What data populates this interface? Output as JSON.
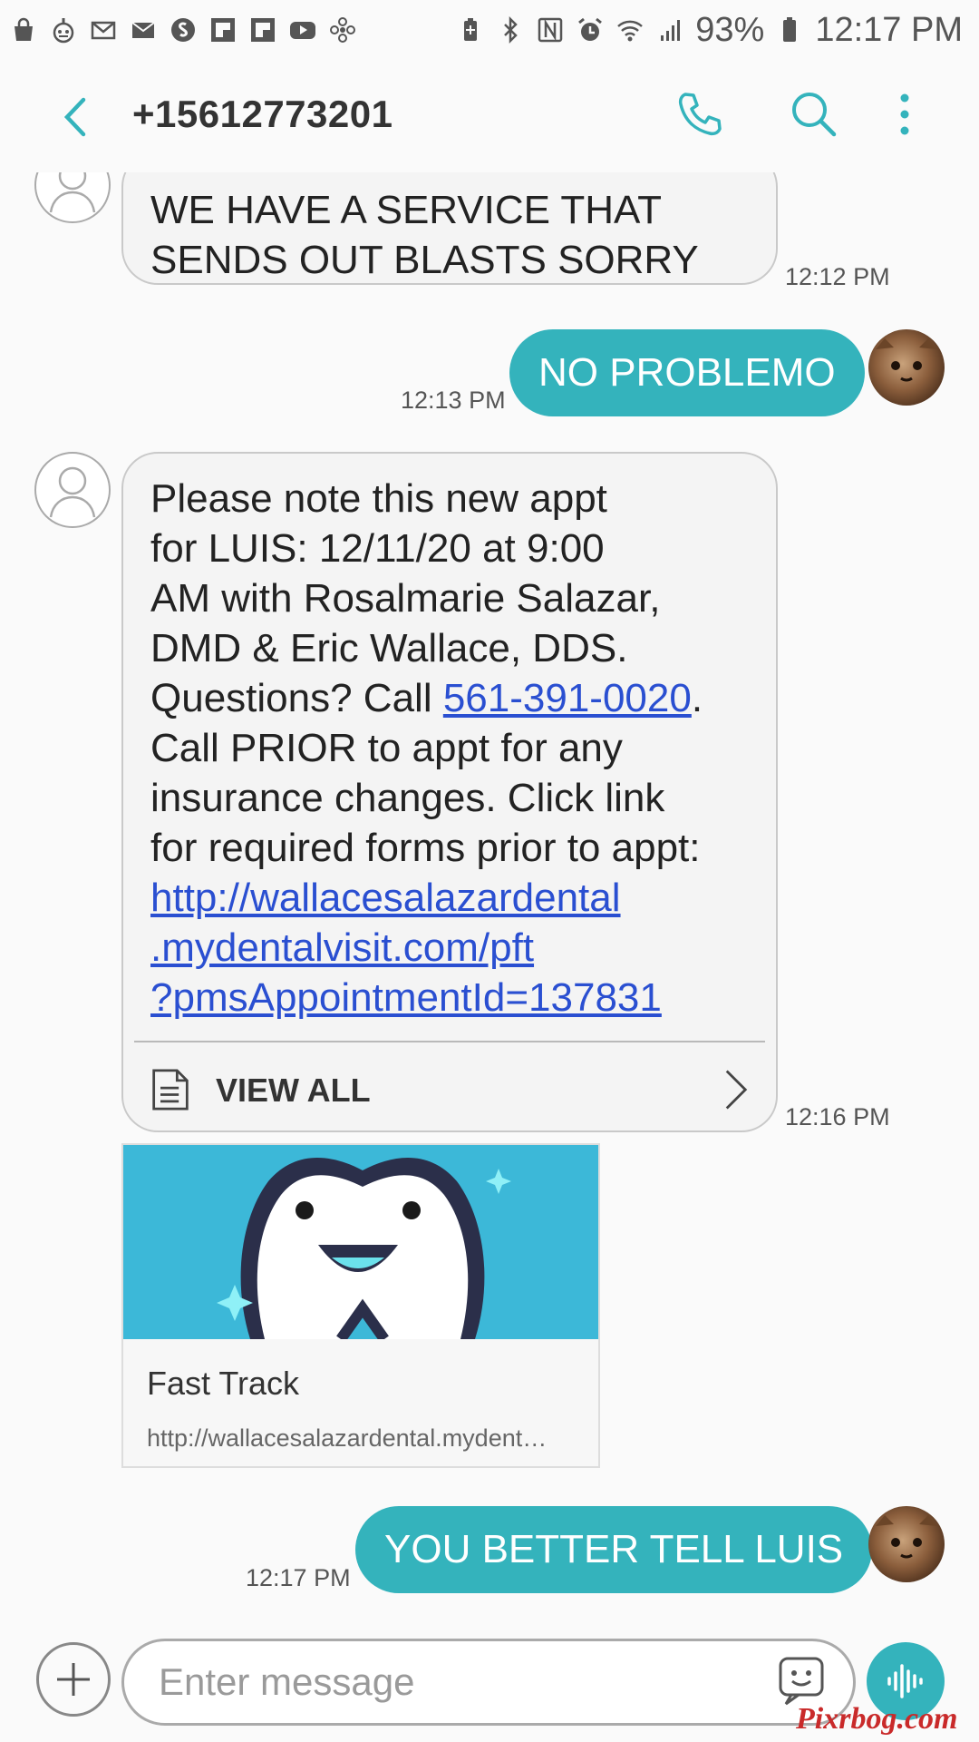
{
  "status_bar": {
    "left_icons": [
      "shopping-bag-icon",
      "bot-icon",
      "gmail-icon",
      "mail-icon",
      "shazam-icon",
      "flipboard-icon",
      "flipboard-icon",
      "youtube-icon",
      "fan-icon"
    ],
    "right_icons": [
      "battery-saver-icon",
      "bluetooth-icon",
      "nfc-icon",
      "alarm-icon",
      "wifi-icon",
      "signal-icon",
      "battery-icon"
    ],
    "battery": "93%",
    "time": "12:17 PM"
  },
  "header": {
    "title": "+15612773201",
    "icons": [
      "back-arrow-icon",
      "phone-icon",
      "search-icon",
      "more-vert-icon"
    ]
  },
  "messages": [
    {
      "direction": "incoming",
      "lines": [
        "WE HAVE A SERVICE THAT",
        "SENDS OUT BLASTS SORRY"
      ],
      "time": "12:12 PM"
    },
    {
      "direction": "outgoing",
      "text": "NO PROBLEMO",
      "time": "12:13 PM"
    },
    {
      "direction": "incoming",
      "lines": [
        "Please note this new appt",
        "for LUIS: 12/11/20 at 9:00",
        "AM with Rosalmarie Salazar,",
        "DMD & Eric Wallace, DDS."
      ],
      "questions_prefix": "Questions? Call ",
      "phone_link": "561-391-0020",
      "questions_suffix": ".",
      "lines_after": [
        "Call PRIOR to appt for any",
        "insurance changes. Click link",
        "for required forms prior to appt:"
      ],
      "url_lines": [
        "http://wallacesalazardental",
        ".mydentalvisit.com/pft",
        "?pmsAppointmentId=137831"
      ],
      "view_all_label": "VIEW ALL",
      "time": "12:16 PM"
    },
    {
      "direction": "outgoing",
      "text": "YOU BETTER TELL LUIS",
      "time": "12:17 PM"
    }
  ],
  "link_preview": {
    "title": "Fast Track",
    "url": "http://wallacesalazardental.mydent…",
    "image_icon": "tooth-mascot-icon",
    "image_color": "#3cb8d8"
  },
  "composer": {
    "placeholder": "Enter message",
    "icons": [
      "add-icon",
      "emoji-icon",
      "voice-icon"
    ]
  },
  "colors": {
    "accent": "#34b3bc",
    "link": "#2a4fd1",
    "incoming_bubble": "#f4f4f4"
  },
  "watermark": "Pixrbog.com"
}
